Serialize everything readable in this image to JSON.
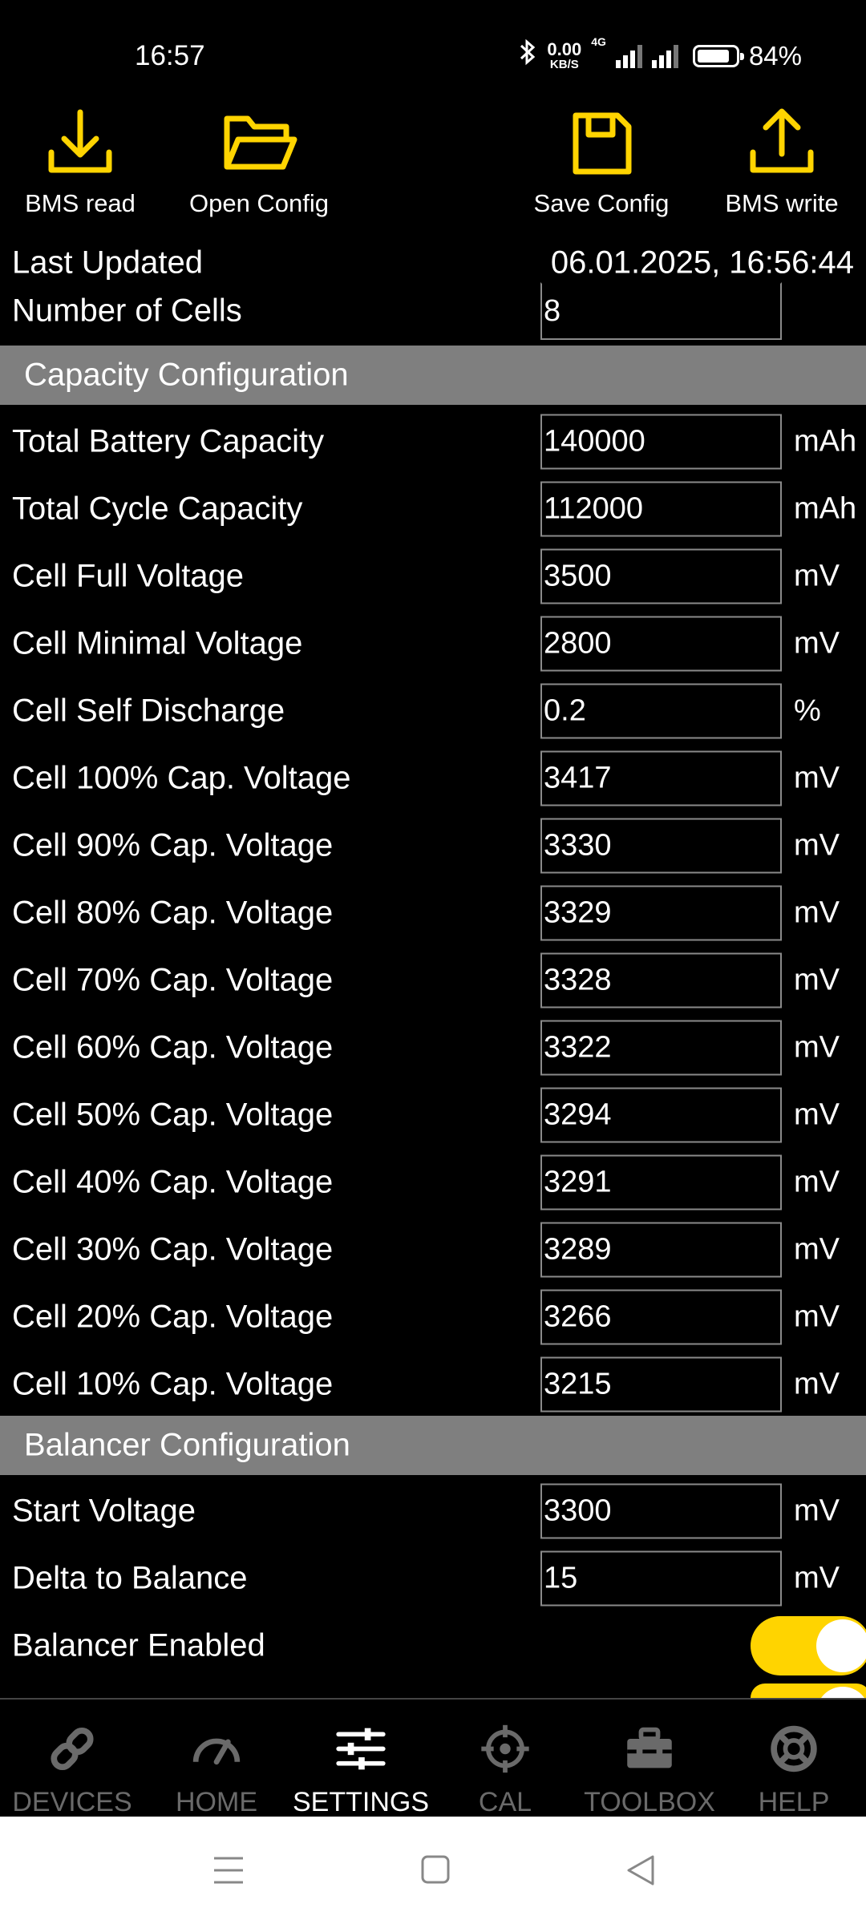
{
  "status_bar": {
    "time": "16:57",
    "net_speed_value": "0.00",
    "net_speed_unit": "KB/S",
    "network_type": "4G",
    "battery_level": 84,
    "battery_text": "84%"
  },
  "toolbar": {
    "bms_read": "BMS read",
    "open_config": "Open Config",
    "save_config": "Save Config",
    "bms_write": "BMS write",
    "icon_color": "#ffd400"
  },
  "info": {
    "last_updated_label": "Last Updated",
    "last_updated_value": "06.01.2025, 16:56:44",
    "num_cells_label": "Number of Cells",
    "num_cells_value": "8"
  },
  "capacity_section": {
    "title": "Capacity Configuration",
    "rows": [
      {
        "label": "Total Battery Capacity",
        "value": "140000",
        "unit": "mAh"
      },
      {
        "label": "Total Cycle Capacity",
        "value": "112000",
        "unit": "mAh"
      },
      {
        "label": "Cell Full Voltage",
        "value": "3500",
        "unit": "mV"
      },
      {
        "label": "Cell Minimal Voltage",
        "value": "2800",
        "unit": "mV"
      },
      {
        "label": "Cell Self Discharge",
        "value": "0.2",
        "unit": "%"
      },
      {
        "label": "Cell 100% Cap. Voltage",
        "value": "3417",
        "unit": "mV"
      },
      {
        "label": "Cell 90% Cap. Voltage",
        "value": "3330",
        "unit": "mV"
      },
      {
        "label": "Cell 80% Cap. Voltage",
        "value": "3329",
        "unit": "mV"
      },
      {
        "label": "Cell 70% Cap. Voltage",
        "value": "3328",
        "unit": "mV"
      },
      {
        "label": "Cell 60% Cap. Voltage",
        "value": "3322",
        "unit": "mV"
      },
      {
        "label": "Cell 50% Cap. Voltage",
        "value": "3294",
        "unit": "mV"
      },
      {
        "label": "Cell 40% Cap. Voltage",
        "value": "3291",
        "unit": "mV"
      },
      {
        "label": "Cell 30% Cap. Voltage",
        "value": "3289",
        "unit": "mV"
      },
      {
        "label": "Cell 20% Cap. Voltage",
        "value": "3266",
        "unit": "mV"
      },
      {
        "label": "Cell 10% Cap. Voltage",
        "value": "3215",
        "unit": "mV"
      }
    ]
  },
  "balancer_section": {
    "title": "Balancer Configuration",
    "rows": [
      {
        "label": "Start Voltage",
        "value": "3300",
        "unit": "mV"
      },
      {
        "label": "Delta to Balance",
        "value": "15",
        "unit": "mV"
      }
    ],
    "enabled_label": "Balancer Enabled",
    "enabled": true,
    "toggle_color": "#ffd400"
  },
  "bottom_nav": {
    "devices": "DEVICES",
    "home": "HOME",
    "settings": "SETTINGS",
    "cal": "CAL",
    "toolbox": "TOOLBOX",
    "help": "HELP",
    "active": "settings"
  }
}
